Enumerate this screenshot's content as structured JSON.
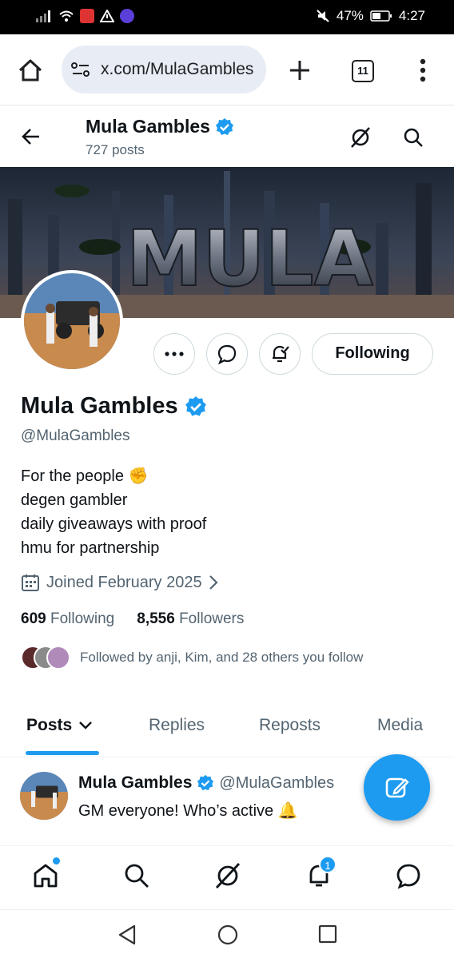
{
  "status_bar": {
    "battery": "47%",
    "time": "4:27"
  },
  "browser": {
    "url": "x.com/MulaGambles",
    "tab_count": "11"
  },
  "profile_header": {
    "title": "Mula Gambles",
    "post_count": "727 posts"
  },
  "banner": {
    "text": "MULA"
  },
  "actions": {
    "follow_label": "Following"
  },
  "profile": {
    "name": "Mula Gambles",
    "handle": "@MulaGambles",
    "bio": [
      "For the people ✊",
      "degen gambler",
      "daily giveaways with proof",
      "hmu for partnership"
    ],
    "joined": "Joined February 2025",
    "following_count": "609",
    "following_label": "Following",
    "followers_count": "8,556",
    "followers_label": "Followers",
    "followed_by": "Followed by anji, Kim, and 28 others you follow"
  },
  "tabs": [
    "Posts",
    "Replies",
    "Reposts",
    "Media"
  ],
  "tweet": {
    "name": "Mula Gambles",
    "handle": "@MulaGambles",
    "text": "GM everyone! Who’s active 🔔"
  },
  "bottom_nav": {
    "notification_badge": "1"
  },
  "colors": {
    "accent": "#1d9bf0",
    "text": "#0f1419",
    "secondary": "#536471",
    "border": "#cfd9de"
  }
}
